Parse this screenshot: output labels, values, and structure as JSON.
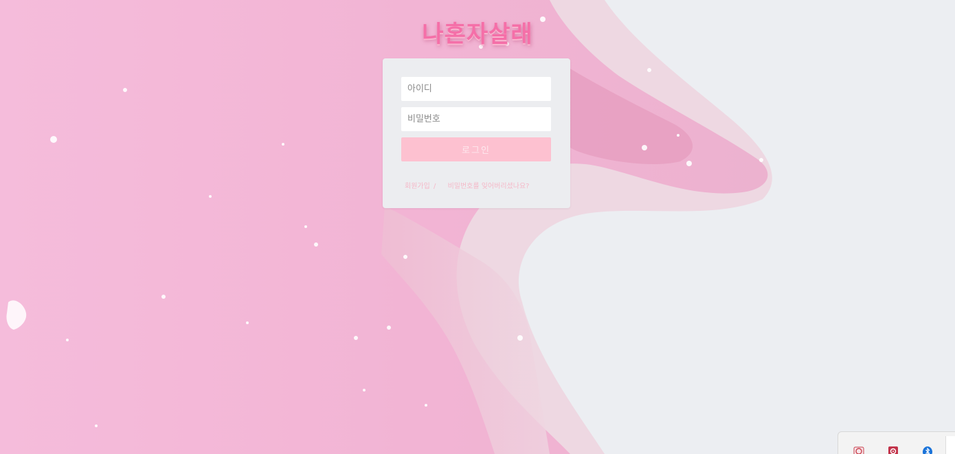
{
  "app": {
    "logo_text": "나혼자살래"
  },
  "login_form": {
    "id_placeholder": "아이디",
    "password_placeholder": "비밀번호",
    "login_button_label": "로그인",
    "signup_link": "회원가입",
    "separator": "/",
    "forgot_password_link": "비밀번호를 잊어버리셨나요?"
  },
  "colors": {
    "brand_pink": "#f56fa8",
    "button_pink": "#fdc1d0",
    "link_pink": "#f5b8c8",
    "card_background": "#ecedf0"
  },
  "system_tray": {
    "icons": [
      "app-icon",
      "settings-app-icon",
      "bluetooth-icon"
    ]
  }
}
